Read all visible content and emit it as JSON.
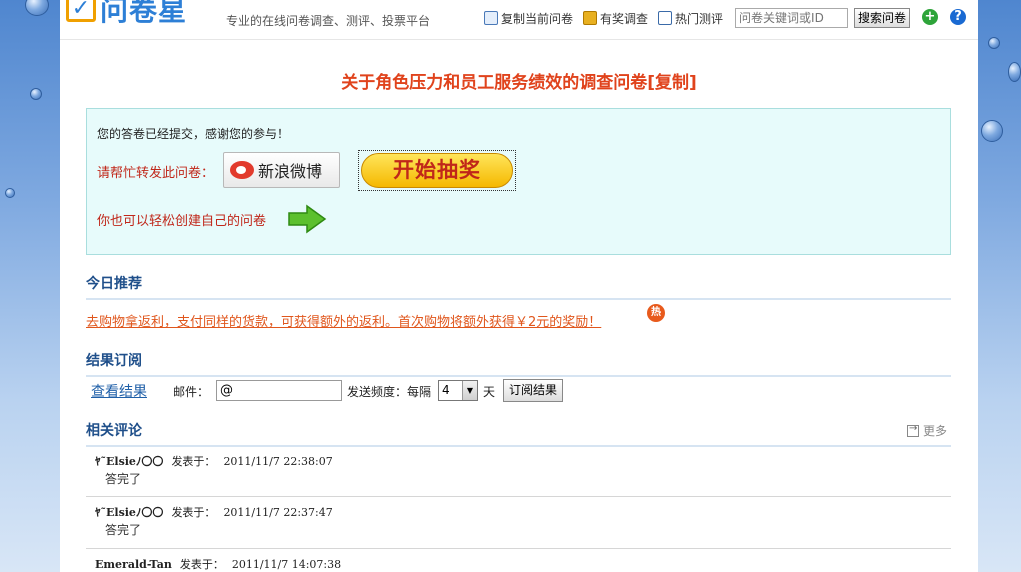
{
  "header": {
    "logo_text": "问卷星",
    "slogan": "专业的在线问卷调查、测评、投票平台",
    "links": [
      {
        "label": "复制当前问卷",
        "icon": "copy-icon"
      },
      {
        "label": "有奖调查",
        "icon": "gift-icon"
      },
      {
        "label": "热门测评",
        "icon": "list-icon"
      }
    ],
    "search_placeholder": "问卷关键词或ID",
    "search_button": "搜索问卷"
  },
  "page_title": "关于角色压力和员工服务绩效的调查问卷[复制]",
  "thanks_box": {
    "submitted_text": "您的答卷已经提交，感谢您的参与！",
    "share_label": "请帮忙转发此问卷：",
    "weibo_label": "新浪微博",
    "lottery_label": "开始抽奖",
    "create_label": "你也可以轻松创建自己的问卷"
  },
  "recommend": {
    "title": "今日推荐",
    "promo_text": "去购物拿返利，支付同样的货款，可获得额外的返利。首次购物将额外获得￥2元的奖励！",
    "hot_badge": "热"
  },
  "subscribe": {
    "title": "结果订阅",
    "view_results": "查看结果",
    "email_label": "邮件：",
    "email_value": "@",
    "freq_label": "发送频度：每隔",
    "freq_value": "4",
    "day_label": "天",
    "button": "订阅结果"
  },
  "comments": {
    "title": "相关评论",
    "more": "更多",
    "posted_label": "发表于：",
    "items": [
      {
        "user": "ﾔ˜Elsieﾉ〇〇",
        "time": "2011/11/7 22:38:07",
        "text": "答完了"
      },
      {
        "user": "ﾔ˜Elsieﾉ〇〇",
        "time": "2011/11/7 22:37:47",
        "text": "答完了"
      },
      {
        "user": "Emerald-Tan",
        "time": "2011/11/7 14:07:38",
        "text": ""
      }
    ]
  },
  "colors": {
    "title_red": "#e0431c",
    "section_blue": "#1f4f8a",
    "box_bg": "#e7fbfb",
    "promo_orange": "#e0561c"
  }
}
